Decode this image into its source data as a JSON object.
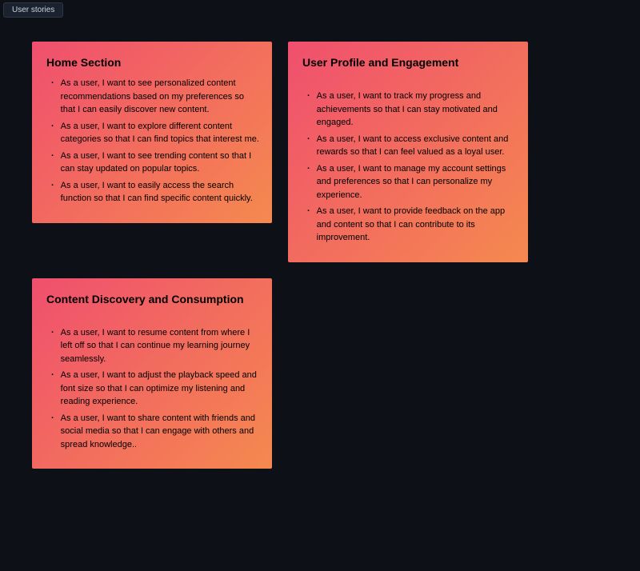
{
  "tab": {
    "label": "User stories"
  },
  "cards": [
    {
      "title": "Home Section",
      "spacer": false,
      "items": [
        "As a user, I want to see personalized content recommendations based on my preferences so that I can easily discover new content.",
        "As a user, I want to explore different content categories so that I can find topics that interest me.",
        "As a user, I want to see trending content so that I can stay updated on popular topics.",
        "As a user, I want to easily access the search function so that I can find specific content quickly."
      ]
    },
    {
      "title": "User Profile and Engagement",
      "spacer": true,
      "items": [
        "As a user, I want to track my progress and achievements so that I can stay motivated and engaged.",
        "As a user, I want to access exclusive content and rewards so that I can feel valued as a loyal user.",
        "As a user, I want to manage my account settings and preferences so that I can personalize my experience.",
        "As a user, I want to provide feedback on the app and content so that I can contribute to its improvement."
      ]
    },
    {
      "title": "Content Discovery and Consumption",
      "spacer": true,
      "items": [
        "As a user, I want to resume content from where I left off so that I can continue my learning journey seamlessly.",
        "As a user, I want to adjust the playback speed and font size so that I can optimize my listening and reading experience.",
        "As a user, I want to share content with friends and social media so that I can engage with others and spread knowledge.."
      ]
    }
  ]
}
